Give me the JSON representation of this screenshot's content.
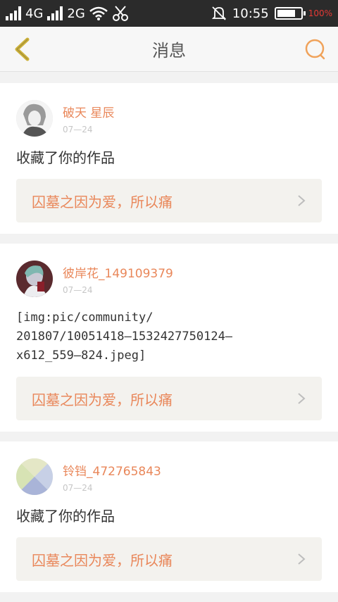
{
  "status_bar": {
    "network_4g": "4G",
    "network_2g": "2G",
    "time": "10:55",
    "battery_label": "100%"
  },
  "header": {
    "title": "消息",
    "back_icon": "back-chevron-icon",
    "search_icon": "search-icon"
  },
  "colors": {
    "accent": "#e9875a",
    "back_icon": "#ccb13a",
    "card_link_bg": "#f3f2ee",
    "date": "#c6c6c6"
  },
  "messages": [
    {
      "username": "破天 星辰",
      "date": "07—24",
      "content": "收藏了你的作品",
      "work_title": "囚墓之因为爱，所以痛"
    },
    {
      "username": "彼岸花_149109379",
      "date": "07—24",
      "content": "[img:pic/community/\n201807/10051418—1532427750124—\nx612_559—824.jpeg]",
      "work_title": "囚墓之因为爱，所以痛"
    },
    {
      "username": "铃铛_472765843",
      "date": "07—24",
      "content": "收藏了你的作品",
      "work_title": "囚墓之因为爱，所以痛"
    }
  ]
}
